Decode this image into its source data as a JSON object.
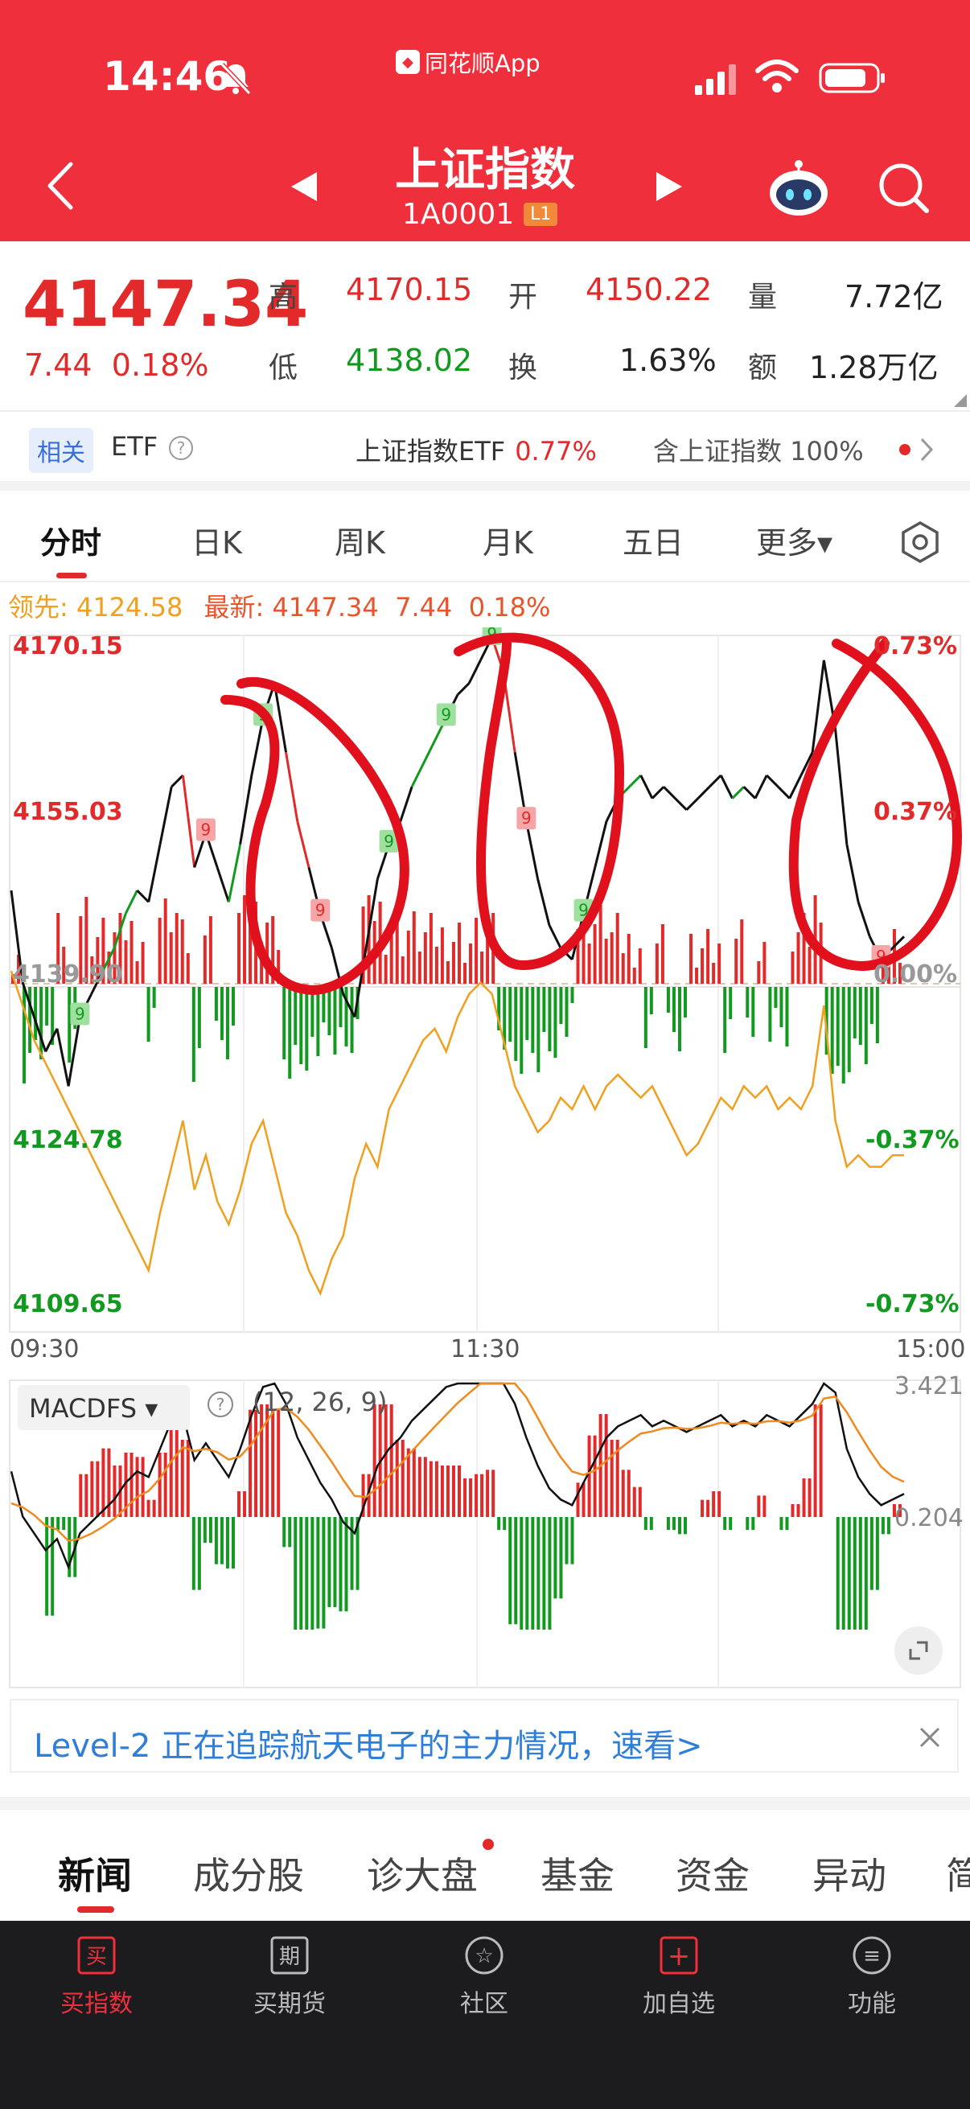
{
  "status_bar": {
    "time": "14:46",
    "source_app": "同花顺App"
  },
  "header": {
    "title": "上证指数",
    "code": "1A0001",
    "level_tag": "L1"
  },
  "quote": {
    "price": "4147.34",
    "change": "7.44",
    "change_pct": "0.18%",
    "fields": {
      "high_label": "高",
      "high": "4170.15",
      "low_label": "低",
      "low": "4138.02",
      "open_label": "开",
      "open": "4150.22",
      "turnover_label": "换",
      "turnover": "1.63%",
      "volume_label": "量",
      "volume": "7.72亿",
      "amount_label": "额",
      "amount": "1.28万亿"
    }
  },
  "etf_row": {
    "tag": "相关",
    "label": "ETF",
    "fund_name": "上证指数ETF",
    "fund_change": "0.77%",
    "contains": "含上证指数 100%"
  },
  "chart_tabs": [
    "分时",
    "日K",
    "周K",
    "月K",
    "五日",
    "更多▾"
  ],
  "chart_legend": {
    "lead_label": "领先:",
    "lead_value": "4124.58",
    "latest_label": "最新:",
    "latest_value": "4147.34",
    "latest_change": "7.44",
    "latest_pct": "0.18%"
  },
  "chart_data": [
    {
      "type": "line",
      "x_labels": [
        "09:30",
        "11:30",
        "15:00"
      ],
      "y_left_labels": [
        "4170.15",
        "4155.03",
        "4139.90",
        "4124.78",
        "4109.65"
      ],
      "y_right_labels": [
        "0.73%",
        "0.37%",
        "0.00%",
        "-0.37%",
        "-0.73%"
      ],
      "ylim": [
        4109.65,
        4170.15
      ],
      "prev_close": 4139.9,
      "series": [
        {
          "values": [
            4148,
            4140,
            4137,
            4134,
            4136,
            4131,
            4137,
            4139,
            4141,
            4143,
            4146,
            4148,
            4147,
            4152,
            4157,
            4158,
            4150,
            4153,
            4150,
            4147,
            4152,
            4158,
            4163,
            4166,
            4160,
            4154,
            4150,
            4146,
            4143,
            4139,
            4137,
            4143,
            4149,
            4152,
            4154,
            4157,
            4159,
            4161,
            4163,
            4165,
            4166,
            4168,
            4170,
            4167,
            4160,
            4154,
            4149,
            4145,
            4143,
            4142,
            4146,
            4150,
            4154,
            4156,
            4157,
            4158,
            4156,
            4157,
            4156,
            4155,
            4156,
            4157,
            4158,
            4156,
            4157,
            4156,
            4158,
            4157,
            4156,
            4158,
            4160,
            4168,
            4162,
            4152,
            4147,
            4144,
            4142,
            4143,
            4144
          ]
        },
        {
          "values": [
            4141,
            4138,
            4135,
            4133,
            4131,
            4129,
            4127,
            4125,
            4123,
            4121,
            4119,
            4117,
            4115,
            4120,
            4124,
            4128,
            4122,
            4125,
            4121,
            4119,
            4122,
            4126,
            4128,
            4124,
            4120,
            4118,
            4115,
            4113,
            4116,
            4118,
            4123,
            4126,
            4124,
            4129,
            4131,
            4133,
            4135,
            4136,
            4134,
            4137,
            4139,
            4140,
            4139,
            4135,
            4131,
            4129,
            4127,
            4128,
            4130,
            4129,
            4131,
            4129,
            4131,
            4132,
            4131,
            4130,
            4131,
            4129,
            4127,
            4125,
            4126,
            4128,
            4130,
            4129,
            4131,
            4130,
            4131,
            4129,
            4130,
            4129,
            4131,
            4138,
            4128,
            4124,
            4125,
            4124,
            4124,
            4125,
            4125
          ]
        }
      ]
    },
    {
      "type": "bar",
      "y_labels": [
        "3.421",
        "0.204"
      ]
    }
  ],
  "macd": {
    "name": "MACDFS",
    "params": "(12, 26, 9)"
  },
  "banner": {
    "text": "Level-2 正在追踪航天电子的主力情况，速看>"
  },
  "news_tabs": [
    "新闻",
    "成分股",
    "诊大盘",
    "基金",
    "资金",
    "异动",
    "简"
  ],
  "bottom_nav": [
    {
      "label": "买指数",
      "glyph": "买"
    },
    {
      "label": "买期货",
      "glyph": "期"
    },
    {
      "label": "社区",
      "glyph": "☆"
    },
    {
      "label": "加自选",
      "glyph": "+"
    },
    {
      "label": "功能",
      "glyph": "≡"
    }
  ],
  "colors": {
    "header": "#ef2f3b",
    "up": "#e22a2a",
    "down": "#119a1f",
    "lead_line": "#f0a01e"
  }
}
